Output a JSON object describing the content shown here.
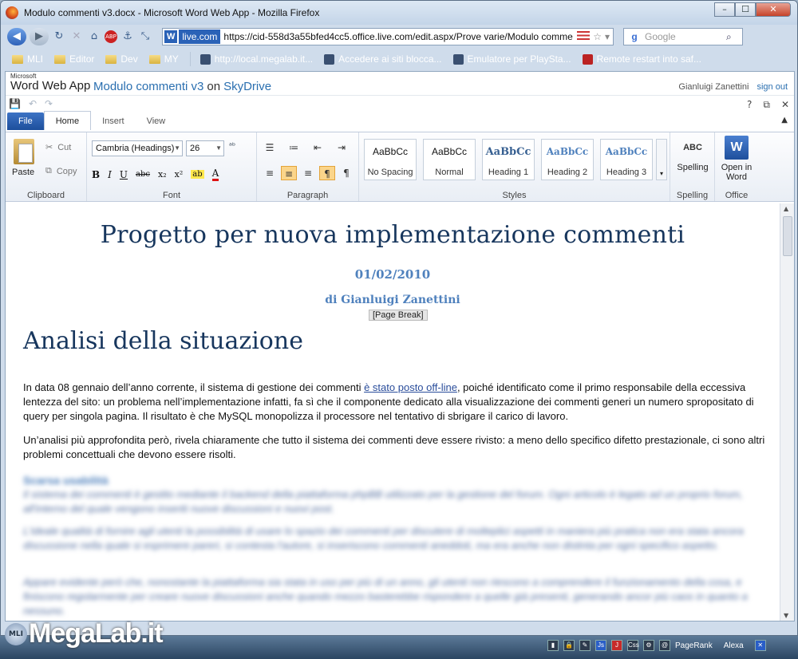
{
  "window": {
    "title": "Modulo commenti v3.docx - Microsoft Word Web App - Mozilla Firefox",
    "min": "–",
    "max": "☐",
    "close": "✕"
  },
  "nav": {
    "back_icon": "◀",
    "forward_icon": "▶",
    "reload_icon": "↻",
    "stop_icon": "✕",
    "home_icon": "⌂",
    "abp_icon": "ABP",
    "site_badge": "W",
    "domain": "live.com",
    "url": "https://cid-558d3a55bfed4cc5.office.live.com/edit.aspx/Prove varie/Modulo comme",
    "search_engine_icon": "g",
    "search_placeholder": "Google",
    "search_icon": "⌕"
  },
  "bookmarks": [
    {
      "label": "MLI",
      "type": "folder"
    },
    {
      "label": "Editor",
      "type": "folder"
    },
    {
      "label": "Dev",
      "type": "folder"
    },
    {
      "label": "MY",
      "type": "folder"
    },
    {
      "label": "http://local.megalab.it...",
      "type": "page"
    },
    {
      "label": "Accedere ai siti blocca...",
      "type": "page"
    },
    {
      "label": "Emulatore per PlaySta...",
      "type": "page"
    },
    {
      "label": "Remote restart into saf...",
      "type": "page"
    }
  ],
  "app": {
    "ms_label": "Microsoft",
    "app_name": "Word Web App",
    "doc_name": "Modulo commenti v3",
    "on": "on",
    "service": "SkyDrive",
    "user": "Gianluigi Zanettini",
    "sign_out": "sign out",
    "help": "?",
    "popout": "⧉",
    "close": "✕",
    "collapse": "▲"
  },
  "tabs": [
    {
      "label": "File"
    },
    {
      "label": "Home"
    },
    {
      "label": "Insert"
    },
    {
      "label": "View"
    }
  ],
  "ribbon": {
    "clipboard": {
      "label": "Clipboard",
      "paste": "Paste",
      "cut": "Cut",
      "copy": "Copy"
    },
    "font": {
      "label": "Font",
      "family": "Cambria (Headings)",
      "size": "26",
      "bold": "B",
      "italic": "I",
      "underline": "U",
      "strike": "abc",
      "sub": "x₂",
      "sup": "x²",
      "highlight": "ab",
      "color": "A"
    },
    "paragraph": {
      "label": "Paragraph"
    },
    "styles": {
      "label": "Styles",
      "items": [
        {
          "sample": "AaBbCc",
          "name": "No Spacing"
        },
        {
          "sample": "AaBbCc",
          "name": "Normal"
        },
        {
          "sample": "AaBbCc",
          "name": "Heading 1"
        },
        {
          "sample": "AaBbCc",
          "name": "Heading 2"
        },
        {
          "sample": "AaBbCc",
          "name": "Heading 3"
        }
      ]
    },
    "spelling": {
      "label": "Spelling",
      "button": "Spelling",
      "icon_text": "ABC"
    },
    "office": {
      "label": "Office",
      "button_line1": "Open in",
      "button_line2": "Word"
    }
  },
  "document": {
    "title": "Progetto per nuova implementazione commenti",
    "date": "01/02/2010",
    "author": "di Gianluigi Zanettini",
    "page_break": "[Page Break]",
    "heading": "Analisi della situazione",
    "p1_before": "In data 08 gennaio dell’anno corrente, il sistema di gestione dei commenti ",
    "p1_link": "è stato posto off-line",
    "p1_after": ", poiché identificato come il primo responsabile della eccessiva lentezza del sito: un problema nell’implementazione infatti, fa sì che il componente dedicato alla visualizzazione dei commenti generi un numero spropositato di query per singola pagina. Il risultato è che MySQL monopolizza il processore nel tentativo di sbrigare il carico di lavoro.",
    "p2": "Un’analisi più approfondita però, rivela chiaramente che tutto il sistema dei commenti deve essere rivisto: a meno dello specifico difetto prestazionale, ci sono altri problemi concettuali che devono essere risolti.",
    "blurred_heading": "Scarsa usabilità",
    "blurred_p1": "Il sistema dei commenti è gestito mediante il backend della piattaforma phpBB utilizzato per la gestione del forum. Ogni articolo è legato ad un proprio forum, all'interno del quale vengono inseriti nuove discussioni e nuovi post.",
    "blurred_p2": "L'ideale qualità di fornire agli utenti la possibilità di usare lo spazio dei commenti per discutere di molteplici aspetti in maniera più pratica non era stata ancora discussione nella quale si esprimere pareri, si contesta l'autore, si inseriscono commenti aneddoti, ma era anche non distinta per ogni specifico aspetto.",
    "blurred_p3": "Appare evidente però che, nonostante la piattaforma sia stata in uso per più di un anno, gli utenti non riescono a comprendere il funzionamento della cosa, e finiscono regolarmente per creare nuove discussioni anche quando mezzo basterebbe rispondere a quelle già presenti, generando ancor più caos in quanto a nessuno."
  },
  "taskbar": {
    "logo": "MegaLab.it",
    "mli_badge": "MLI",
    "tray": [
      "Js",
      "J",
      "Css",
      "PageRank",
      "Alexa"
    ]
  }
}
